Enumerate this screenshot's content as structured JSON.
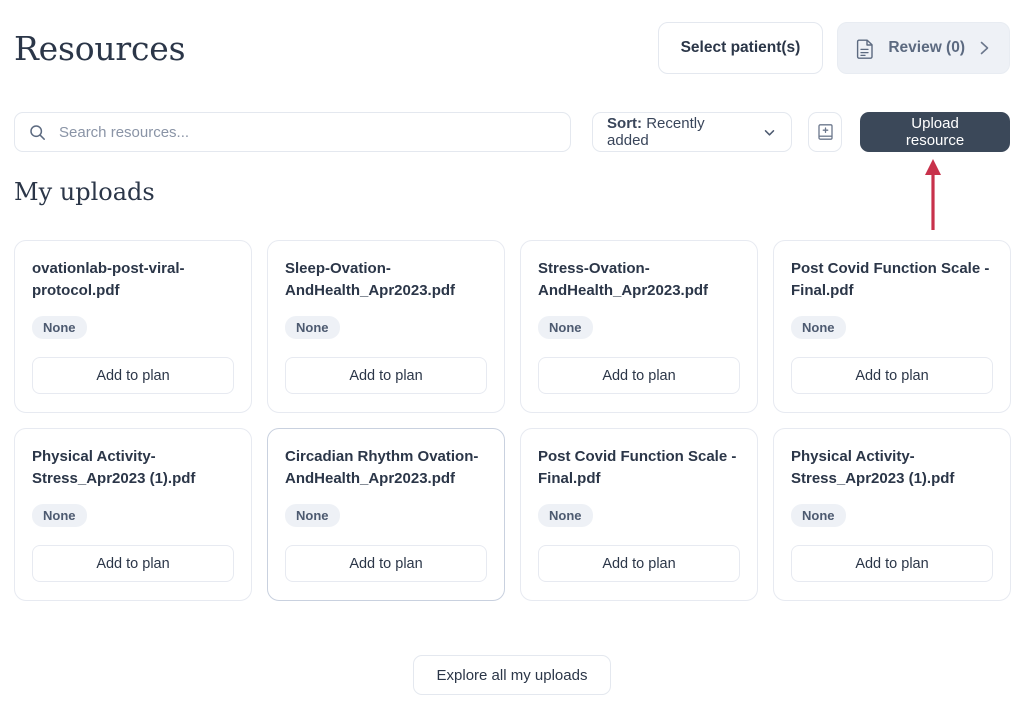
{
  "header": {
    "title": "Resources",
    "select_patients_label": "Select patient(s)",
    "review_label": "Review (0)",
    "review_icon": "document-icon",
    "review_chevron_icon": "chevron-right-icon"
  },
  "toolbar": {
    "search_placeholder": "Search resources...",
    "search_value": "",
    "search_icon": "search-icon",
    "sort_prefix": "Sort:",
    "sort_value": "Recently added",
    "sort_chevron_icon": "chevron-down-icon",
    "library_icon": "book-add-icon",
    "upload_label": "Upload resource"
  },
  "section": {
    "title": "My uploads"
  },
  "cards": [
    {
      "title": "ovationlab-post-viral-protocol.pdf",
      "badge": "None",
      "action": "Add to plan",
      "hovered": false
    },
    {
      "title": "Sleep-Ovation-AndHealth_Apr2023.pdf",
      "badge": "None",
      "action": "Add to plan",
      "hovered": false
    },
    {
      "title": "Stress-Ovation-AndHealth_Apr2023.pdf",
      "badge": "None",
      "action": "Add to plan",
      "hovered": false
    },
    {
      "title": "Post Covid Function Scale - Final.pdf",
      "badge": "None",
      "action": "Add to plan",
      "hovered": false
    },
    {
      "title": "Physical Activity-Stress_Apr2023 (1).pdf",
      "badge": "None",
      "action": "Add to plan",
      "hovered": false
    },
    {
      "title": "Circadian Rhythm Ovation-AndHealth_Apr2023.pdf",
      "badge": "None",
      "action": "Add to plan",
      "hovered": true
    },
    {
      "title": "Post Covid Function Scale - Final.pdf",
      "badge": "None",
      "action": "Add to plan",
      "hovered": false
    },
    {
      "title": "Physical Activity-Stress_Apr2023 (1).pdf",
      "badge": "None",
      "action": "Add to plan",
      "hovered": false
    }
  ],
  "footer": {
    "explore_label": "Explore all my uploads"
  },
  "annotation": {
    "arrow_icon": "up-arrow-annotation",
    "color": "#c8324b",
    "points_to": "Upload resource"
  },
  "colors": {
    "page_background": "#ffffff",
    "text_primary": "#2b3648",
    "text_muted": "#5c6a80",
    "border": "#e4e8ef",
    "badge_background": "#eef1f6",
    "accent_dark": "#3b4859",
    "annotation_red": "#c8324b"
  }
}
